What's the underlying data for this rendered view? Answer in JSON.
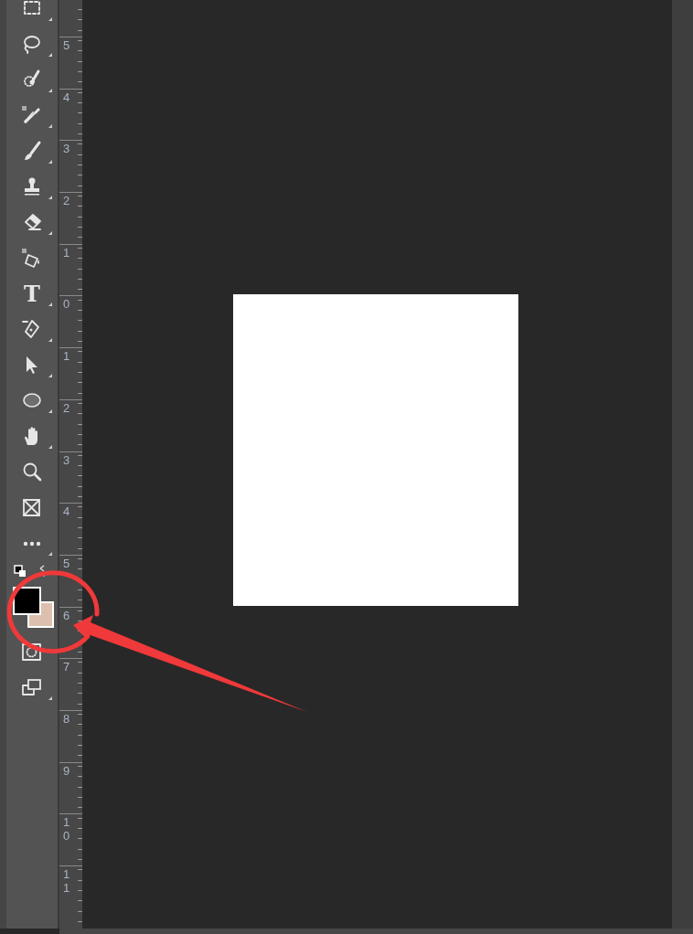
{
  "type_tool": {
    "glyph": "T"
  },
  "color_swatches": [
    {
      "color": "#000000"
    },
    {
      "color": "#dcc0ad"
    }
  ],
  "vertical_ruler": {
    "labels": [
      "5",
      "4",
      "3",
      "2",
      "1",
      "0",
      "1",
      "2",
      "3",
      "4",
      "5",
      "6",
      "7",
      "8",
      "9",
      "10",
      "11"
    ]
  }
}
